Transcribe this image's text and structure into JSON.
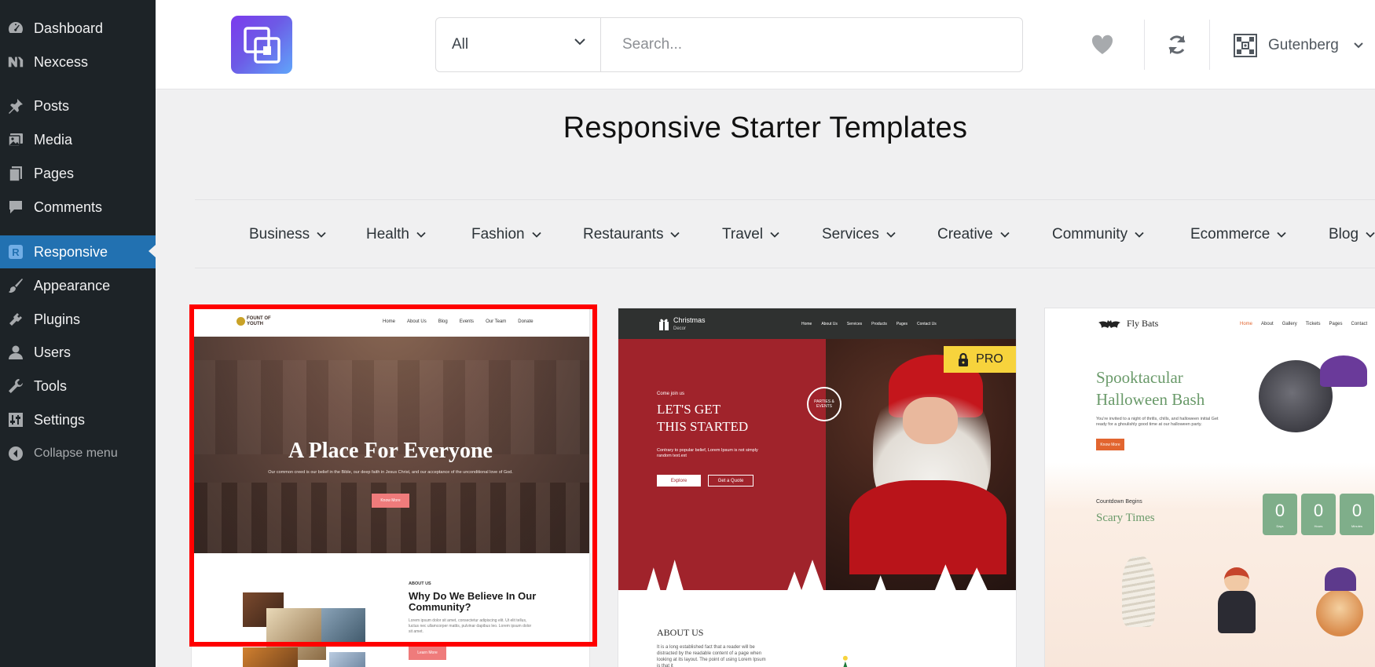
{
  "sidebar": {
    "items": [
      {
        "label": "Dashboard",
        "icon": "dashboard-icon"
      },
      {
        "label": "Nexcess",
        "icon": "nexcess-icon"
      },
      {
        "label": "Posts",
        "icon": "pin-icon"
      },
      {
        "label": "Media",
        "icon": "media-icon"
      },
      {
        "label": "Pages",
        "icon": "pages-icon"
      },
      {
        "label": "Comments",
        "icon": "comments-icon"
      },
      {
        "label": "Responsive",
        "icon": "responsive-r-icon",
        "active": true
      },
      {
        "label": "Appearance",
        "icon": "brush-icon"
      },
      {
        "label": "Plugins",
        "icon": "plug-icon"
      },
      {
        "label": "Users",
        "icon": "users-icon"
      },
      {
        "label": "Tools",
        "icon": "wrench-icon"
      },
      {
        "label": "Settings",
        "icon": "settings-sliders-icon"
      },
      {
        "label": "Collapse menu",
        "icon": "collapse-arrow-icon"
      }
    ],
    "active_color": "#2271b1"
  },
  "header": {
    "category_select": "All",
    "search_placeholder": "Search...",
    "builder_label": "Gutenberg"
  },
  "page": {
    "title": "Responsive Starter Templates"
  },
  "categories": [
    "Business",
    "Health",
    "Fashion",
    "Restaurants",
    "Travel",
    "Services",
    "Creative",
    "Community",
    "Ecommerce",
    "Blog"
  ],
  "cards": {
    "c1": {
      "brand_line1": "FOUNT OF",
      "brand_line2": "YOUTH",
      "nav": [
        "Home",
        "About Us",
        "Blog",
        "Events",
        "Our Team",
        "Donate"
      ],
      "hero_title": "A Place For Everyone",
      "hero_sub": "Our common creed is our belief in the Bible, our deep faith in Jesus Christ, and our acceptance of the unconditional love of God.",
      "hero_btn": "Know More",
      "kicker": "ABOUT US",
      "heading": "Why Do We Believe In Our Community?",
      "para": "Lorem ipsum dolor sit amet, consectetur adipiscing elit. Ut elit tellus, luctus nec ullamcorper mattis, pulvinar dapibus leo. Lorem ipsum dolor sit amet.",
      "btn2": "Learn More"
    },
    "c2": {
      "brand": "Christmas",
      "brand_sub": "Decor",
      "nav": [
        "Home",
        "About Us",
        "Services",
        "Products",
        "Pages",
        "Contact Us"
      ],
      "pro": "PRO",
      "kicker": "Come join us",
      "hero_line1": "LET'S GET",
      "hero_line2": "THIS STARTED",
      "para": "Contrary to popular belief, Lorem Ipsum is not simply random text.ext",
      "btn1": "Explore",
      "btn2": "Get a Quote",
      "badge": "PARTIES & EVENTS",
      "about": "ABOUT US",
      "about_p": "It is a long established fact that a reader will be distracted by the readable content of a page when looking at its layout. The point of using Lorem Ipsum is that it"
    },
    "c3": {
      "brand": "Fly Bats",
      "nav": [
        "Home",
        "About",
        "Gallery",
        "Tickets",
        "Pages",
        "Contact"
      ],
      "hero_line1": "Spooktacular",
      "hero_line2": "Halloween Bash",
      "para": "You're invited to a night of thrills, chills, and halloween initial Get ready for a ghoulishly good time at our halloween party.",
      "btn": "Know More",
      "countdown_kicker": "Countdown Begins",
      "countdown_title": "Scary Times",
      "countdown": [
        {
          "value": "0",
          "unit": "Days"
        },
        {
          "value": "0",
          "unit": "Hours"
        },
        {
          "value": "0",
          "unit": "Minutes"
        }
      ]
    }
  }
}
